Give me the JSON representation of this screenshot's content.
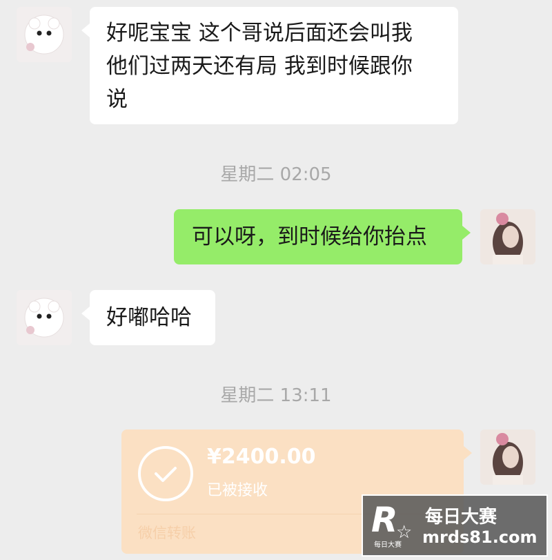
{
  "messages": [
    {
      "text_lines": [
        "好呢宝宝 这个哥说后面还会叫我",
        "他们过两天还有局 我到时候跟你",
        "说"
      ]
    },
    {
      "text": "可以呀，到时候给你抬点"
    },
    {
      "text": "好嘟哈哈"
    }
  ],
  "timestamps": [
    "星期二 02:05",
    "星期二 13:11"
  ],
  "transfer": {
    "amount": "¥2400.00",
    "status": "已被接收",
    "label": "微信转账"
  },
  "watermark": {
    "logo_letter": "R",
    "logo_small": "每日大赛",
    "site_name": "每日大赛",
    "url": "mrds81.com"
  },
  "colors": {
    "background": "#ededed",
    "incoming_bubble": "#ffffff",
    "outgoing_bubble": "#95ec69",
    "transfer_card": "#fbe0c3",
    "timestamp_text": "#a8a8a8"
  }
}
